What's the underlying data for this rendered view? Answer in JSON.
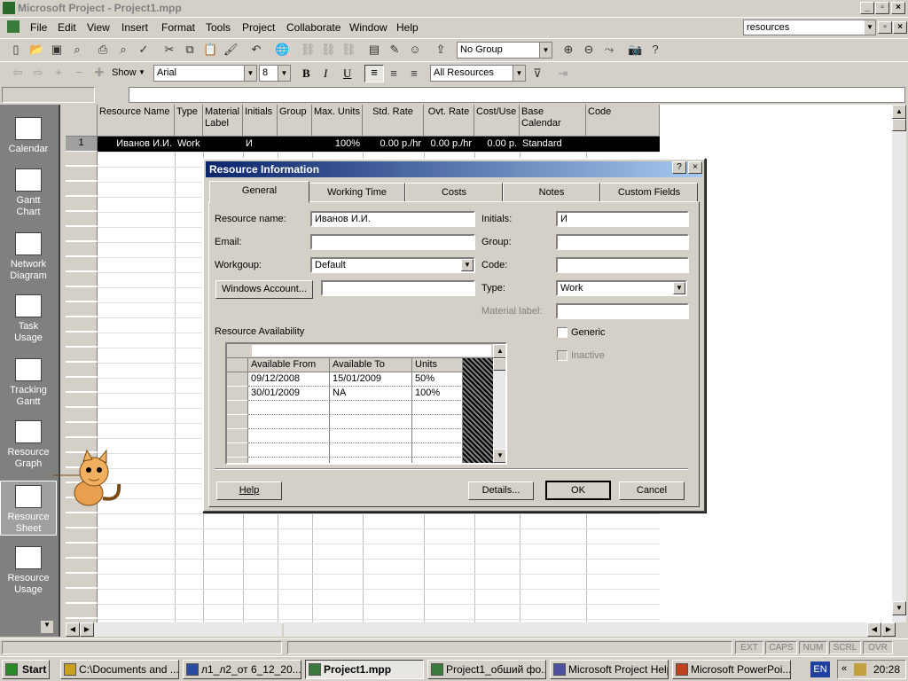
{
  "window": {
    "title": "Microsoft Project - Project1.mpp"
  },
  "menu": [
    "File",
    "Edit",
    "View",
    "Insert",
    "Format",
    "Tools",
    "Project",
    "Collaborate",
    "Window",
    "Help"
  ],
  "help_search": "resources",
  "toolbar": {
    "group_combo": "No Group",
    "show_label": "Show",
    "font_combo": "Arial",
    "size_combo": "8",
    "filter_combo": "All Resources",
    "bold": "B",
    "italic": "I",
    "underline": "U"
  },
  "view_bar": [
    {
      "label": "Calendar",
      "icon": "calendar-icon"
    },
    {
      "label": "Gantt Chart",
      "icon": "gantt-chart-icon"
    },
    {
      "label": "Network Diagram",
      "icon": "network-diagram-icon"
    },
    {
      "label": "Task Usage",
      "icon": "task-usage-icon"
    },
    {
      "label": "Tracking Gantt",
      "icon": "tracking-gantt-icon"
    },
    {
      "label": "Resource Graph",
      "icon": "resource-graph-icon"
    },
    {
      "label": "Resource Sheet",
      "icon": "resource-sheet-icon"
    },
    {
      "label": "Resource Usage",
      "icon": "resource-usage-icon"
    }
  ],
  "sheet": {
    "columns": [
      "Resource Name",
      "Type",
      "Material Label",
      "Initials",
      "Group",
      "Max. Units",
      "Std. Rate",
      "Ovt. Rate",
      "Cost/Use",
      "Base Calendar",
      "Code"
    ],
    "rows": [
      {
        "id": "1",
        "cells": [
          "Иванов И.И.",
          "Work",
          "",
          "И",
          "",
          "100%",
          "0.00 р./hr",
          "0.00 р./hr",
          "0.00 р.",
          "Standard",
          ""
        ]
      }
    ]
  },
  "dialog": {
    "title": "Resource Information",
    "tabs": [
      "General",
      "Working Time",
      "Costs",
      "Notes",
      "Custom Fields"
    ],
    "fields": {
      "resource_name_label": "Resource name:",
      "resource_name": "Иванов И.И.",
      "email_label": "Email:",
      "email": "",
      "workgroup_label": "Workgoup:",
      "workgroup": "Default",
      "windows_account_button": "Windows Account...",
      "windows_account": "",
      "initials_label": "Initials:",
      "initials": "И",
      "group_label": "Group:",
      "group": "",
      "code_label": "Code:",
      "code": "",
      "type_label": "Type:",
      "type": "Work",
      "material_label_label": "Material label:",
      "material_label": "",
      "generic_label": "Generic",
      "inactive_label": "Inactive"
    },
    "availability": {
      "label": "Resource Availability",
      "columns": [
        "Available From",
        "Available To",
        "Units"
      ],
      "rows": [
        [
          "09/12/2008",
          "15/01/2009",
          "50%"
        ],
        [
          "30/01/2009",
          "NA",
          "100%"
        ]
      ]
    },
    "buttons": {
      "help": "Help",
      "details": "Details...",
      "ok": "OK",
      "cancel": "Cancel"
    }
  },
  "status_bar": [
    "EXT",
    "CAPS",
    "NUM",
    "SCRL",
    "OVR"
  ],
  "taskbar": {
    "start": "Start",
    "tasks": [
      "C:\\Documents and ...",
      "л1_л2_от 6_12_20...",
      "Project1.mpp",
      "Project1_обший фо...",
      "Microsoft Project Help",
      "Microsoft PowerPoi..."
    ],
    "lang": "EN",
    "clock": "20:28"
  }
}
